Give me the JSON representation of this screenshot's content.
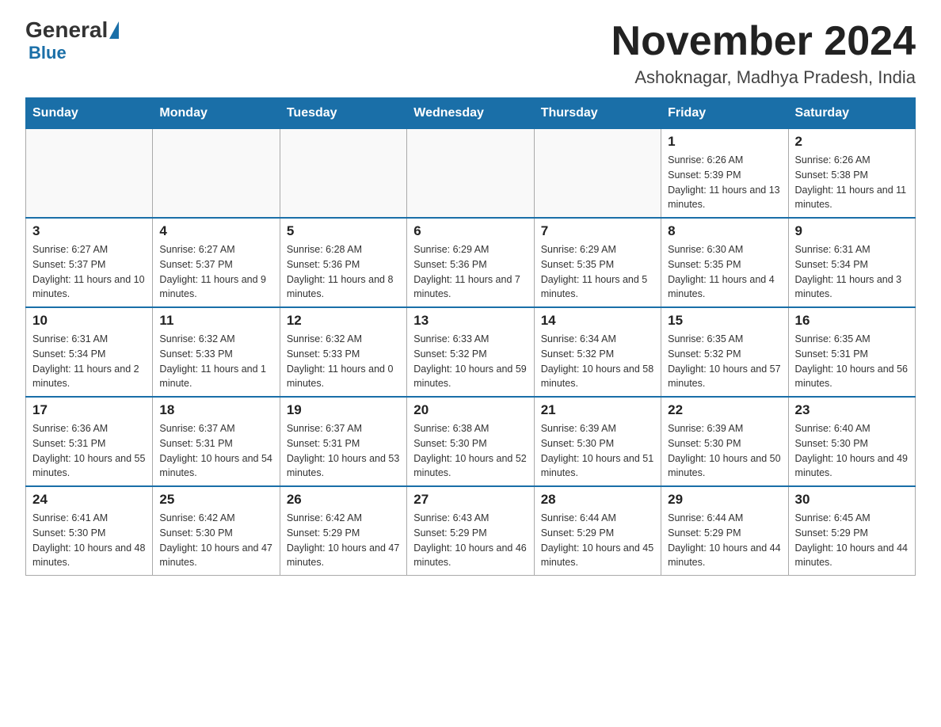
{
  "header": {
    "logo_general": "General",
    "logo_blue": "Blue",
    "title": "November 2024",
    "subtitle": "Ashoknagar, Madhya Pradesh, India"
  },
  "days": [
    "Sunday",
    "Monday",
    "Tuesday",
    "Wednesday",
    "Thursday",
    "Friday",
    "Saturday"
  ],
  "weeks": [
    [
      {
        "date": "",
        "info": ""
      },
      {
        "date": "",
        "info": ""
      },
      {
        "date": "",
        "info": ""
      },
      {
        "date": "",
        "info": ""
      },
      {
        "date": "",
        "info": ""
      },
      {
        "date": "1",
        "info": "Sunrise: 6:26 AM\nSunset: 5:39 PM\nDaylight: 11 hours and 13 minutes."
      },
      {
        "date": "2",
        "info": "Sunrise: 6:26 AM\nSunset: 5:38 PM\nDaylight: 11 hours and 11 minutes."
      }
    ],
    [
      {
        "date": "3",
        "info": "Sunrise: 6:27 AM\nSunset: 5:37 PM\nDaylight: 11 hours and 10 minutes."
      },
      {
        "date": "4",
        "info": "Sunrise: 6:27 AM\nSunset: 5:37 PM\nDaylight: 11 hours and 9 minutes."
      },
      {
        "date": "5",
        "info": "Sunrise: 6:28 AM\nSunset: 5:36 PM\nDaylight: 11 hours and 8 minutes."
      },
      {
        "date": "6",
        "info": "Sunrise: 6:29 AM\nSunset: 5:36 PM\nDaylight: 11 hours and 7 minutes."
      },
      {
        "date": "7",
        "info": "Sunrise: 6:29 AM\nSunset: 5:35 PM\nDaylight: 11 hours and 5 minutes."
      },
      {
        "date": "8",
        "info": "Sunrise: 6:30 AM\nSunset: 5:35 PM\nDaylight: 11 hours and 4 minutes."
      },
      {
        "date": "9",
        "info": "Sunrise: 6:31 AM\nSunset: 5:34 PM\nDaylight: 11 hours and 3 minutes."
      }
    ],
    [
      {
        "date": "10",
        "info": "Sunrise: 6:31 AM\nSunset: 5:34 PM\nDaylight: 11 hours and 2 minutes."
      },
      {
        "date": "11",
        "info": "Sunrise: 6:32 AM\nSunset: 5:33 PM\nDaylight: 11 hours and 1 minute."
      },
      {
        "date": "12",
        "info": "Sunrise: 6:32 AM\nSunset: 5:33 PM\nDaylight: 11 hours and 0 minutes."
      },
      {
        "date": "13",
        "info": "Sunrise: 6:33 AM\nSunset: 5:32 PM\nDaylight: 10 hours and 59 minutes."
      },
      {
        "date": "14",
        "info": "Sunrise: 6:34 AM\nSunset: 5:32 PM\nDaylight: 10 hours and 58 minutes."
      },
      {
        "date": "15",
        "info": "Sunrise: 6:35 AM\nSunset: 5:32 PM\nDaylight: 10 hours and 57 minutes."
      },
      {
        "date": "16",
        "info": "Sunrise: 6:35 AM\nSunset: 5:31 PM\nDaylight: 10 hours and 56 minutes."
      }
    ],
    [
      {
        "date": "17",
        "info": "Sunrise: 6:36 AM\nSunset: 5:31 PM\nDaylight: 10 hours and 55 minutes."
      },
      {
        "date": "18",
        "info": "Sunrise: 6:37 AM\nSunset: 5:31 PM\nDaylight: 10 hours and 54 minutes."
      },
      {
        "date": "19",
        "info": "Sunrise: 6:37 AM\nSunset: 5:31 PM\nDaylight: 10 hours and 53 minutes."
      },
      {
        "date": "20",
        "info": "Sunrise: 6:38 AM\nSunset: 5:30 PM\nDaylight: 10 hours and 52 minutes."
      },
      {
        "date": "21",
        "info": "Sunrise: 6:39 AM\nSunset: 5:30 PM\nDaylight: 10 hours and 51 minutes."
      },
      {
        "date": "22",
        "info": "Sunrise: 6:39 AM\nSunset: 5:30 PM\nDaylight: 10 hours and 50 minutes."
      },
      {
        "date": "23",
        "info": "Sunrise: 6:40 AM\nSunset: 5:30 PM\nDaylight: 10 hours and 49 minutes."
      }
    ],
    [
      {
        "date": "24",
        "info": "Sunrise: 6:41 AM\nSunset: 5:30 PM\nDaylight: 10 hours and 48 minutes."
      },
      {
        "date": "25",
        "info": "Sunrise: 6:42 AM\nSunset: 5:30 PM\nDaylight: 10 hours and 47 minutes."
      },
      {
        "date": "26",
        "info": "Sunrise: 6:42 AM\nSunset: 5:29 PM\nDaylight: 10 hours and 47 minutes."
      },
      {
        "date": "27",
        "info": "Sunrise: 6:43 AM\nSunset: 5:29 PM\nDaylight: 10 hours and 46 minutes."
      },
      {
        "date": "28",
        "info": "Sunrise: 6:44 AM\nSunset: 5:29 PM\nDaylight: 10 hours and 45 minutes."
      },
      {
        "date": "29",
        "info": "Sunrise: 6:44 AM\nSunset: 5:29 PM\nDaylight: 10 hours and 44 minutes."
      },
      {
        "date": "30",
        "info": "Sunrise: 6:45 AM\nSunset: 5:29 PM\nDaylight: 10 hours and 44 minutes."
      }
    ]
  ]
}
